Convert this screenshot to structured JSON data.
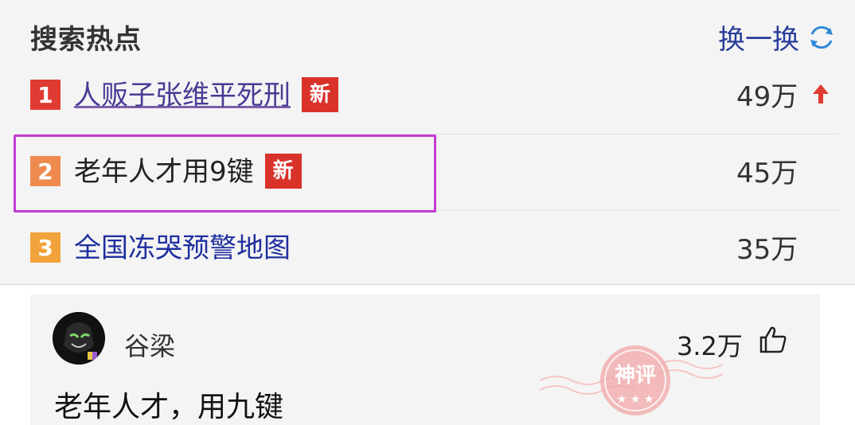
{
  "hot_search": {
    "title": "搜索热点",
    "refresh_label": "换一换",
    "items": [
      {
        "rank": "1",
        "title": "人贩子张维平死刑",
        "badge": "新",
        "count": "49万",
        "rank_color": "#e03b32",
        "trend": "up"
      },
      {
        "rank": "2",
        "title": "老年人才用9键",
        "badge": "新",
        "count": "45万",
        "rank_color": "#ee8a4e"
      },
      {
        "rank": "3",
        "title": "全国冻哭预警地图",
        "badge": "",
        "count": "35万",
        "rank_color": "#f2a23a"
      }
    ]
  },
  "comment": {
    "username": "谷梁",
    "likes": "3.2万",
    "text": "老年人才，用九键",
    "stamp_text": "神评"
  },
  "colors": {
    "highlight_border": "#c43cd3",
    "badge_red": "#d9322b",
    "link_blue": "#1f2f9f",
    "stamp_pink": "#f2a7a7"
  },
  "icons": [
    "refresh-icon",
    "trend-up-icon",
    "thumbs-up-icon",
    "avatar",
    "stamp"
  ]
}
